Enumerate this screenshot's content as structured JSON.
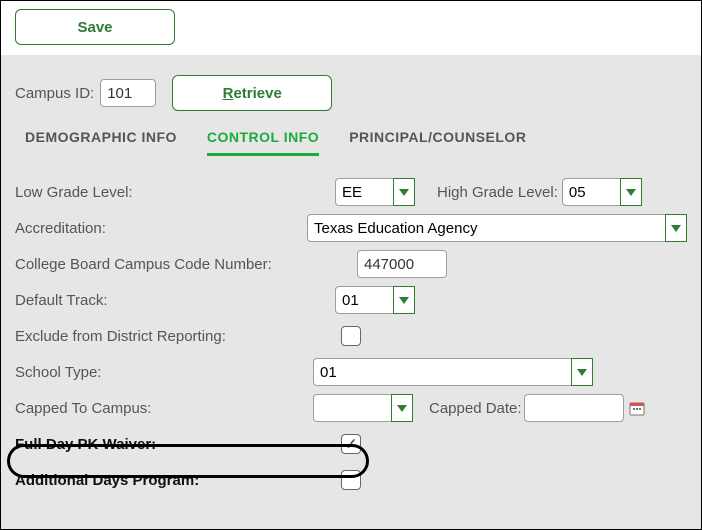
{
  "toolbar": {
    "save_label": "Save"
  },
  "lookup": {
    "campus_id_label": "Campus ID:",
    "campus_id_value": "101",
    "retrieve_label": "Retrieve"
  },
  "tabs": {
    "demographic": "DEMOGRAPHIC INFO",
    "control": "CONTROL INFO",
    "principal": "PRINCIPAL/COUNSELOR"
  },
  "fields": {
    "low_grade": {
      "label": "Low Grade Level:",
      "value": "EE"
    },
    "high_grade": {
      "label": "High Grade Level:",
      "value": "05"
    },
    "accreditation": {
      "label": "Accreditation:",
      "value": "Texas Education Agency"
    },
    "college_board": {
      "label": "College Board Campus Code Number:",
      "value": "447000"
    },
    "default_track": {
      "label": "Default Track:",
      "value": "01"
    },
    "exclude_district": {
      "label": "Exclude from District Reporting:",
      "checked": false
    },
    "school_type": {
      "label": "School Type:",
      "value": "01"
    },
    "capped_to_campus": {
      "label": "Capped To Campus:",
      "value": ""
    },
    "capped_date": {
      "label": "Capped Date:",
      "value": ""
    },
    "full_day_pk": {
      "label": "Full Day PK Waiver:",
      "checked": true
    },
    "additional_days": {
      "label": "Additional Days Program:",
      "checked": false
    }
  }
}
